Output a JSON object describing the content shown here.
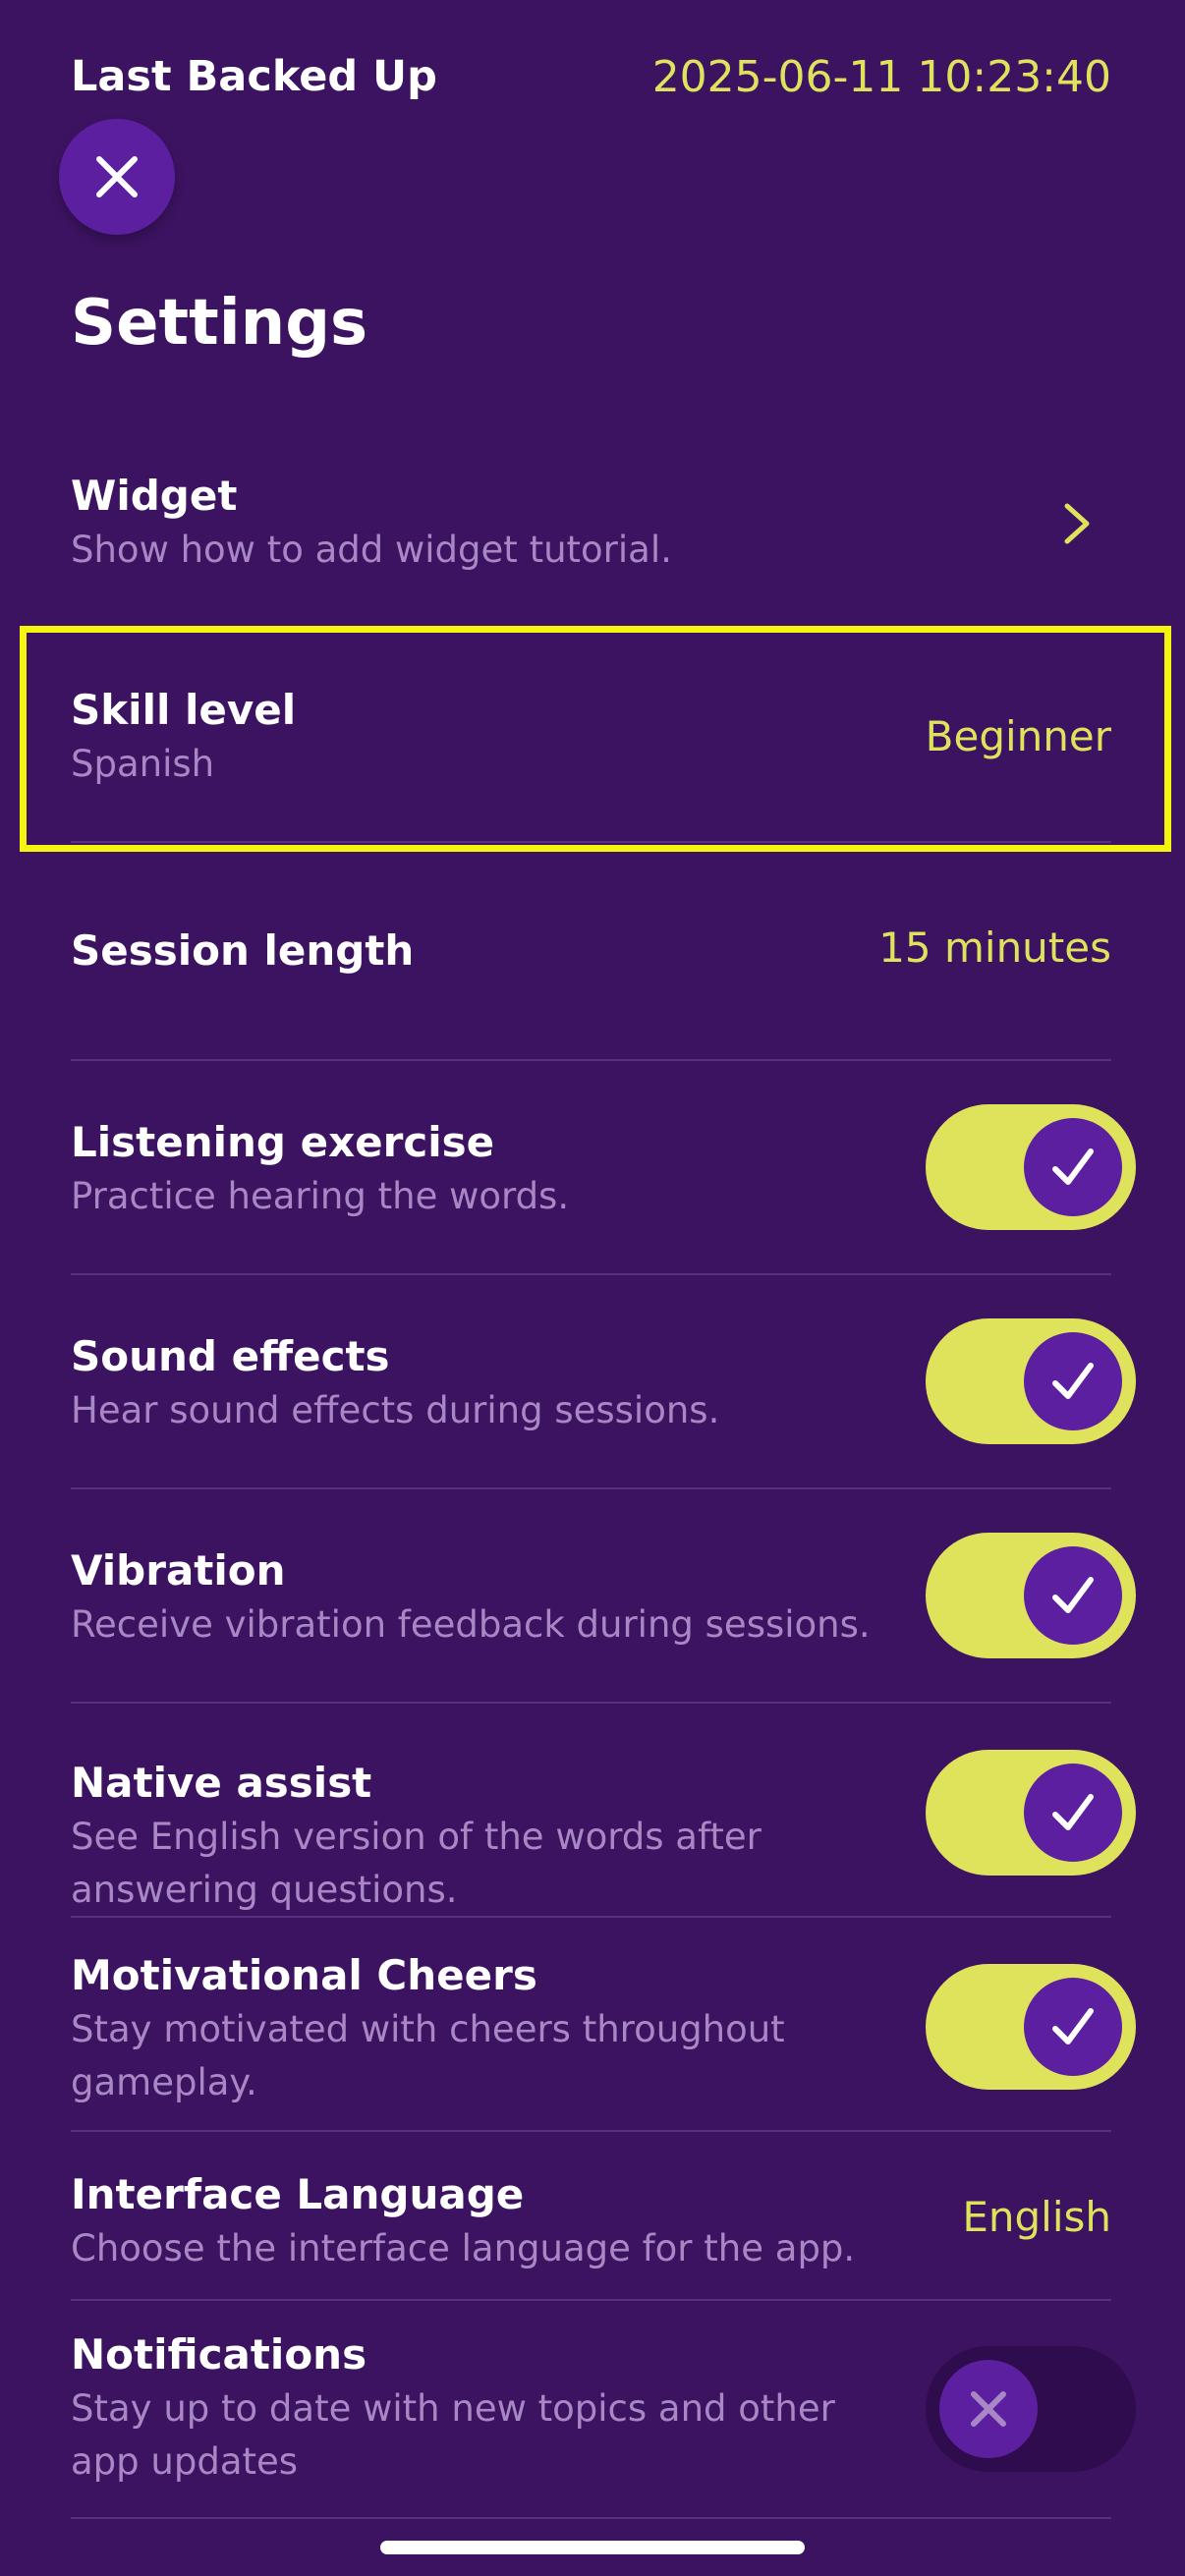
{
  "backup": {
    "label": "Last Backed Up",
    "timestamp": "2025-06-11 10:23:40"
  },
  "header": {
    "title": "Settings",
    "close_icon": "close-icon"
  },
  "settings": {
    "widget": {
      "title": "Widget",
      "subtitle": "Show how to add widget tutorial."
    },
    "skill_level": {
      "title": "Skill level",
      "subtitle": "Spanish",
      "value": "Beginner"
    },
    "session_length": {
      "title": "Session length",
      "value": "15 minutes"
    },
    "listening": {
      "title": "Listening exercise",
      "subtitle": "Practice hearing the words.",
      "on": true
    },
    "sound": {
      "title": "Sound effects",
      "subtitle": "Hear sound effects during sessions.",
      "on": true
    },
    "vibration": {
      "title": "Vibration",
      "subtitle": "Receive vibration feedback during sessions.",
      "on": true
    },
    "native_assist": {
      "title": "Native assist",
      "subtitle_line1": "See English version of the words after",
      "subtitle_line2": "answering questions.",
      "on": true
    },
    "cheers": {
      "title": "Motivational Cheers",
      "subtitle_line1": "Stay motivated with cheers throughout",
      "subtitle_line2": "gameplay.",
      "on": true
    },
    "interface_language": {
      "title": "Interface Language",
      "subtitle": "Choose the interface language for the app.",
      "value": "English"
    },
    "notifications": {
      "title": "Notifications",
      "subtitle_line1": "Stay up to date with new topics and other",
      "subtitle_line2": "app updates",
      "on": false
    }
  },
  "colors": {
    "background": "#3c1361",
    "accent": "#dfe35c",
    "knob": "#5b1fa0",
    "highlight": "#f4f40c"
  }
}
